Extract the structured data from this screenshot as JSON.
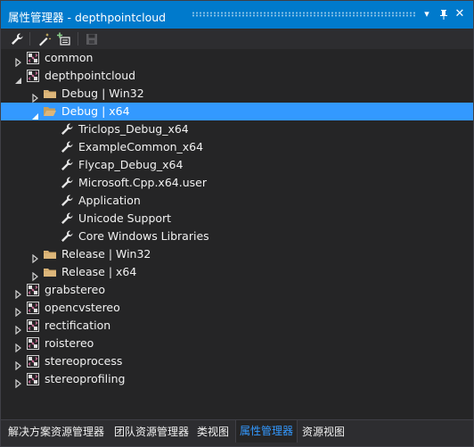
{
  "window": {
    "title": "属性管理器 - depthpointcloud",
    "dropdown_glyph": "▾",
    "pin_glyph": "⊓",
    "close_glyph": "✕"
  },
  "toolbar": {
    "items": [
      {
        "name": "properties",
        "icon": "wrench-icon"
      },
      {
        "name": "add-new-property-sheet",
        "icon": "wand-icon"
      },
      {
        "name": "add-existing-property-sheet",
        "icon": "add-sheet-icon"
      },
      {
        "name": "save",
        "icon": "save-icon",
        "enabled": false
      }
    ]
  },
  "tree": {
    "rows": [
      {
        "label": "common",
        "depth": 0,
        "icon": "project-icon",
        "expander": "collapsed"
      },
      {
        "label": "depthpointcloud",
        "depth": 0,
        "icon": "project-icon",
        "expander": "expanded"
      },
      {
        "label": "Debug | Win32",
        "depth": 1,
        "icon": "folder-icon",
        "expander": "collapsed"
      },
      {
        "label": "Debug | x64",
        "depth": 1,
        "icon": "folder-open-icon",
        "expander": "expanded",
        "selected": true
      },
      {
        "label": "Triclops_Debug_x64",
        "depth": 2,
        "icon": "wrench-icon",
        "expander": "none"
      },
      {
        "label": "ExampleCommon_x64",
        "depth": 2,
        "icon": "wrench-icon",
        "expander": "none"
      },
      {
        "label": "Flycap_Debug_x64",
        "depth": 2,
        "icon": "wrench-icon",
        "expander": "none"
      },
      {
        "label": "Microsoft.Cpp.x64.user",
        "depth": 2,
        "icon": "wrench-icon",
        "expander": "none"
      },
      {
        "label": "Application",
        "depth": 2,
        "icon": "wrench-icon",
        "expander": "none"
      },
      {
        "label": "Unicode Support",
        "depth": 2,
        "icon": "wrench-icon",
        "expander": "none"
      },
      {
        "label": "Core Windows Libraries",
        "depth": 2,
        "icon": "wrench-icon",
        "expander": "none"
      },
      {
        "label": "Release | Win32",
        "depth": 1,
        "icon": "folder-icon",
        "expander": "collapsed"
      },
      {
        "label": "Release | x64",
        "depth": 1,
        "icon": "folder-icon",
        "expander": "collapsed"
      },
      {
        "label": "grabstereo",
        "depth": 0,
        "icon": "project-icon",
        "expander": "collapsed"
      },
      {
        "label": "opencvstereo",
        "depth": 0,
        "icon": "project-icon",
        "expander": "collapsed"
      },
      {
        "label": "rectification",
        "depth": 0,
        "icon": "project-icon",
        "expander": "collapsed"
      },
      {
        "label": "roistereo",
        "depth": 0,
        "icon": "project-icon",
        "expander": "collapsed"
      },
      {
        "label": "stereoprocess",
        "depth": 0,
        "icon": "project-icon",
        "expander": "collapsed"
      },
      {
        "label": "stereoprofiling",
        "depth": 0,
        "icon": "project-icon",
        "expander": "collapsed"
      }
    ]
  },
  "tabs": [
    {
      "label": "解决方案资源管理器"
    },
    {
      "label": "团队资源管理器"
    },
    {
      "label": "类视图"
    },
    {
      "label": "属性管理器",
      "active": true
    },
    {
      "label": "资源视图"
    }
  ],
  "colors": {
    "accent": "#007acc",
    "selection": "#3399ff",
    "background": "#252526",
    "folder": "#dcb67a",
    "active_tab_text": "#3399ff"
  }
}
